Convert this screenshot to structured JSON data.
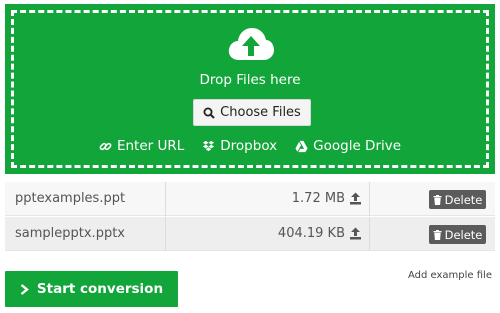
{
  "upload": {
    "cloud_icon": "cloud-upload-icon",
    "drop_text": "Drop Files here",
    "choose_label": "Choose Files",
    "sources": [
      {
        "label": "Enter URL",
        "icon": "link-icon"
      },
      {
        "label": "Dropbox",
        "icon": "dropbox-icon"
      },
      {
        "label": "Google Drive",
        "icon": "google-drive-icon"
      }
    ]
  },
  "files": [
    {
      "name": "pptexamples.ppt",
      "size": "1.72 MB",
      "delete_label": "Delete"
    },
    {
      "name": "samplepptx.pptx",
      "size": "404.19 KB",
      "delete_label": "Delete"
    }
  ],
  "actions": {
    "start_label": "Start conversion",
    "add_example_label": "Add example file"
  },
  "colors": {
    "brand_green": "#12a53a",
    "delete_gray": "#5b5b5b"
  }
}
